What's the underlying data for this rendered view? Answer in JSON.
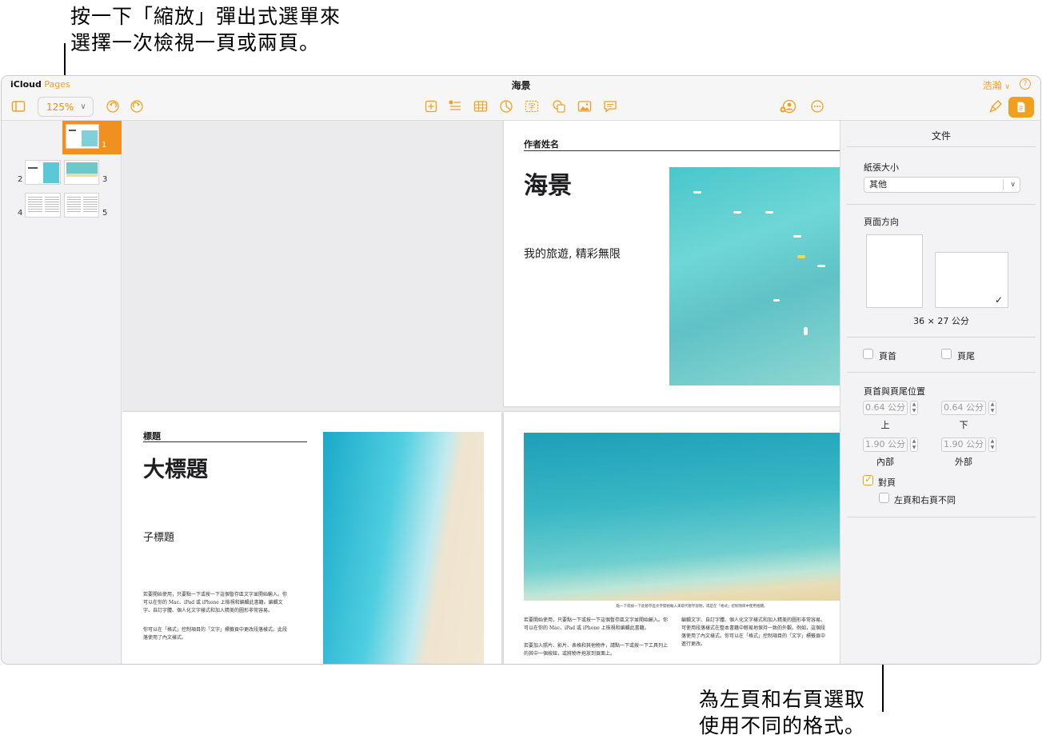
{
  "callouts": {
    "top_line1": "按一下「縮放」彈出式選單來",
    "top_line2": "選擇一次檢視一頁或兩頁。",
    "bottom_line1": "為左頁和右頁選取",
    "bottom_line2": "使用不同的格式。"
  },
  "app": {
    "brand_icloud": "iCloud",
    "brand_pages": "Pages",
    "document_title": "海景",
    "user_menu": "浩瀚",
    "help": "?"
  },
  "toolbar": {
    "zoom_value": "125%",
    "icons": [
      "sidebar-icon",
      "undo-icon",
      "redo-icon",
      "insert-icon",
      "list-icon",
      "table-icon",
      "chart-icon",
      "text-icon",
      "shape-icon",
      "media-icon",
      "comment-icon",
      "collaborate-icon",
      "more-icon",
      "format-brush-icon",
      "document-icon"
    ],
    "text_glyph": "字"
  },
  "thumbnails": {
    "page_numbers": [
      "1",
      "2",
      "3",
      "4",
      "5"
    ]
  },
  "pages": {
    "cover": {
      "author_label": "作者姓名",
      "title": "海景",
      "subtitle": "我的旅遊, 精彩無限"
    },
    "left": {
      "eyebrow": "標題",
      "title": "大標題",
      "subtitle": "子標題",
      "body1": "若要開始使用，只要點一下或按一下這個暫存區文字並開始輸入。你可以在你的 Mac、iPad 或 iPhone 上檢視和編輯此書籍。編輯文字、自訂字體、個人化文字樣式和加入精美的圖形非常容易。",
      "body2": "你可以在「格式」控制項目的「文字」標籤頁中更改段落樣式。此段落使用了內文樣式。"
    },
    "right": {
      "caption": "點一下或按一下此暫存區文字開始輸入來取代暫存說明，或是在「格式」控制項目中使用相關。",
      "col1a": "若要開始使用，只要點一下或按一下這個暫存區文字並開始輸入。你可以在你的 Mac、iPad 或 iPhone 上檢視和編輯此書籍。",
      "col1b": "若要加入照片、影片、表格和其他物件，請點一下或按一下工具列上的其中一個按鈕，或將物件拖放到頁面上。",
      "col2": "編輯文字、自訂字體、個人化文字樣式和加入精美的圖形非常容易。可使用段落樣式在整本書籍中輕易地保持一致的外觀。例如，這個段落使用了內文樣式。你可以在「格式」控制項目的「文字」標籤頁中進行更改。"
    }
  },
  "inspector": {
    "header": "文件",
    "paper_size_label": "紙張大小",
    "paper_size_value": "其他",
    "orientation_label": "頁面方向",
    "dimensions": "36 × 27 公分",
    "header_checkbox": "頁首",
    "footer_checkbox": "頁尾",
    "hf_position_label": "頁首與頁尾位置",
    "top_value": "0.64 公分",
    "top_label": "上",
    "bottom_value": "0.64 公分",
    "bottom_label": "下",
    "inside_value": "1.90 公分",
    "inside_label": "內部",
    "outside_value": "1.90 公分",
    "outside_label": "外部",
    "facing_pages_label": "對頁",
    "facing_pages_checked": true,
    "different_lr_label": "左頁和右頁不同",
    "different_lr_checked": false,
    "accent_color": "#f0a020"
  }
}
